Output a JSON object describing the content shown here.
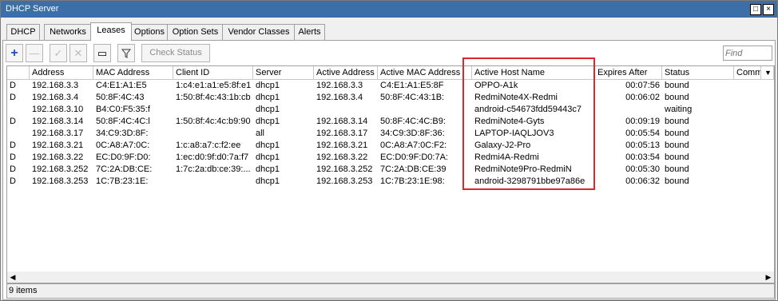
{
  "window": {
    "title": "DHCP Server"
  },
  "tabs": [
    {
      "label": "DHCP"
    },
    {
      "label": "Networks"
    },
    {
      "label": "Leases",
      "active": true
    },
    {
      "label": "Options"
    },
    {
      "label": "Option Sets"
    },
    {
      "label": "Vendor Classes"
    },
    {
      "label": "Alerts"
    }
  ],
  "toolbar": {
    "check_status_label": "Check Status",
    "find_placeholder": "Find"
  },
  "table": {
    "headers": [
      "",
      "Address",
      "MAC Address",
      "Client ID",
      "Server",
      "Active Address",
      "Active MAC Address",
      "Active Host Name",
      "Expires After",
      "Status",
      "Comme"
    ],
    "rows": [
      [
        "D",
        "192.168.3.3",
        "C4:E1:A1:E5",
        "1:c4:e1:a1:e5:8f:e1",
        "dhcp1",
        "192.168.3.3",
        "C4:E1:A1:E5:8F",
        "OPPO-A1k",
        "00:07:56",
        "bound",
        ""
      ],
      [
        "D",
        "192.168.3.4",
        "50:8F:4C:43",
        "1:50:8f:4c:43:1b:cb",
        "dhcp1",
        "192.168.3.4",
        "50:8F:4C:43:1B:",
        "RedmiNote4X-Redmi",
        "00:06:02",
        "bound",
        ""
      ],
      [
        "",
        "192.168.3.10",
        "B4:C0:F5:35:f",
        "",
        "dhcp1",
        "",
        "",
        "android-c54673fdd59443c7",
        "",
        "waiting",
        ""
      ],
      [
        "D",
        "192.168.3.14",
        "50:8F:4C:4C:l",
        "1:50:8f:4c:4c:b9:90",
        "dhcp1",
        "192.168.3.14",
        "50:8F:4C:4C:B9:",
        "RedmiNote4-Gyts",
        "00:09:19",
        "bound",
        ""
      ],
      [
        "",
        "192.168.3.17",
        "34:C9:3D:8F:",
        "",
        "all",
        "192.168.3.17",
        "34:C9:3D:8F:36:",
        "LAPTOP-IAQLJOV3",
        "00:05:54",
        "bound",
        ""
      ],
      [
        "D",
        "192.168.3.21",
        "0C:A8:A7:0C:",
        "1:c:a8:a7:c:f2:ee",
        "dhcp1",
        "192.168.3.21",
        "0C:A8:A7:0C:F2:",
        "Galaxy-J2-Pro",
        "00:05:13",
        "bound",
        ""
      ],
      [
        "D",
        "192.168.3.22",
        "EC:D0:9F:D0:",
        "1:ec:d0:9f:d0:7a:f7",
        "dhcp1",
        "192.168.3.22",
        "EC:D0:9F:D0:7A:",
        "Redmi4A-Redmi",
        "00:03:54",
        "bound",
        ""
      ],
      [
        "D",
        "192.168.3.252",
        "7C:2A:DB:CE:",
        "1:7c:2a:db:ce:39:...",
        "dhcp1",
        "192.168.3.252",
        "7C:2A:DB:CE:39",
        "RedmiNote9Pro-RedmiN",
        "00:05:30",
        "bound",
        ""
      ],
      [
        "D",
        "192.168.3.253",
        "1C:7B:23:1E:",
        "",
        "dhcp1",
        "192.168.3.253",
        "1C:7B:23:1E:98:",
        "android-3298791bbe97a86e",
        "00:06:32",
        "bound",
        ""
      ]
    ]
  },
  "status": {
    "items_count": "9 items"
  },
  "colors": {
    "titlebar": "#3c6ea7",
    "highlight": "#e0252b"
  }
}
